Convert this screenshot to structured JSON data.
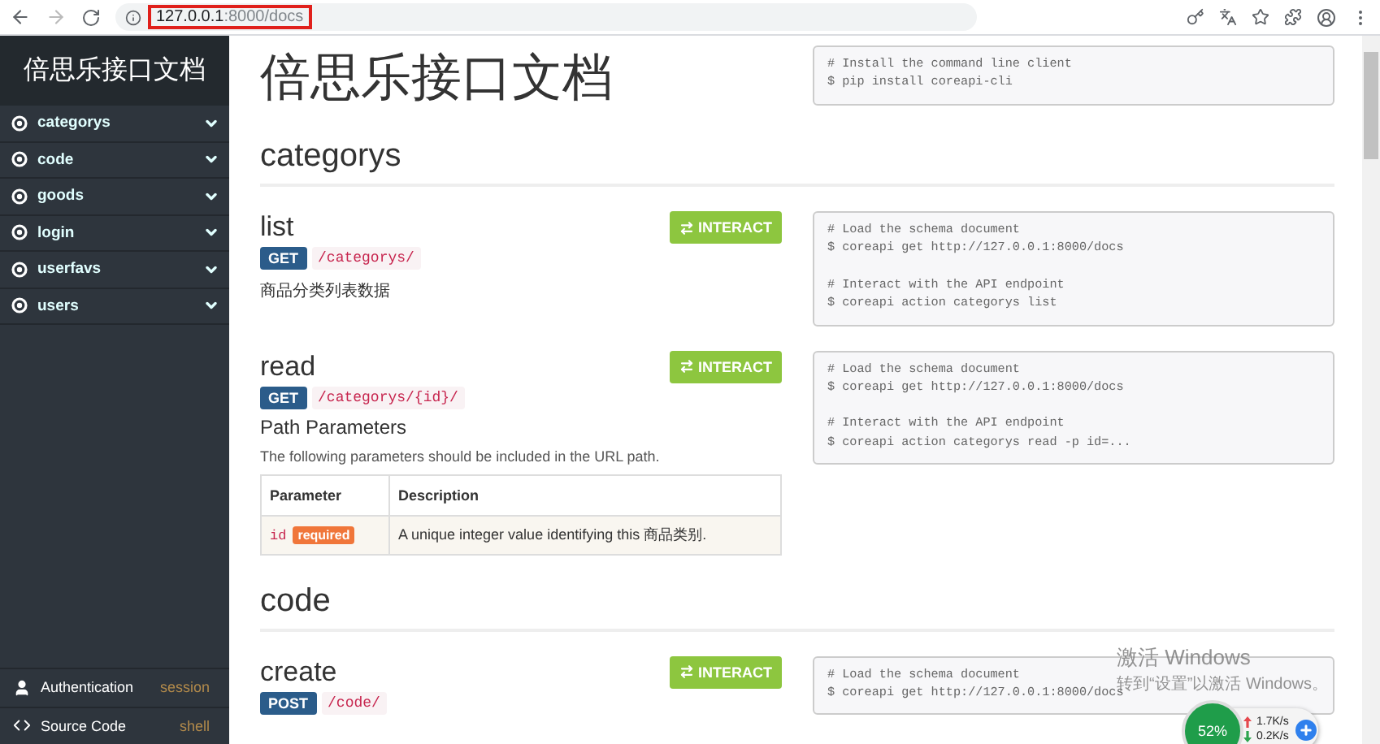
{
  "browser": {
    "url_host": "127.0.0.1",
    "url_rest": ":8000/docs"
  },
  "sidebar": {
    "title": "倍思乐接口文档",
    "items": [
      {
        "label": "categorys",
        "expanded": false
      },
      {
        "label": "code",
        "expanded": false
      },
      {
        "label": "goods",
        "expanded": false
      },
      {
        "label": "login",
        "expanded": false
      },
      {
        "label": "userfavs",
        "expanded": false
      },
      {
        "label": "users",
        "expanded": false
      }
    ],
    "footer": [
      {
        "kind": "auth",
        "label": "Authentication",
        "value": "session"
      },
      {
        "kind": "source",
        "label": "Source Code",
        "value": "shell"
      }
    ]
  },
  "intro": {
    "title": "倍思乐接口文档",
    "code": [
      [
        "# Install the command line client",
        "$ pip install coreapi-cli"
      ]
    ]
  },
  "sections": [
    {
      "title": "categorys",
      "endpoints": [
        {
          "name": "list",
          "button": "INTERACT",
          "method": "GET",
          "path": "/categorys/",
          "description": "商品分类列表数据",
          "code": [
            [
              "# Load the schema document",
              "$ coreapi get http://127.0.0.1:8000/docs"
            ],
            [
              "# Interact with the API endpoint",
              "$ coreapi action categorys list"
            ]
          ]
        },
        {
          "name": "read",
          "button": "INTERACT",
          "method": "GET",
          "path": "/categorys/{id}/",
          "params": {
            "heading": "Path Parameters",
            "note": "The following parameters should be included in the URL path.",
            "columns": [
              "Parameter",
              "Description"
            ],
            "rows": [
              {
                "name": "id",
                "badge": "required",
                "description": "A unique integer value identifying this 商品类别."
              }
            ]
          },
          "code": [
            [
              "# Load the schema document",
              "$ coreapi get http://127.0.0.1:8000/docs"
            ],
            [
              "# Interact with the API endpoint",
              "$ coreapi action categorys read -p id=..."
            ]
          ]
        }
      ]
    },
    {
      "title": "code",
      "endpoints": [
        {
          "name": "create",
          "button": "INTERACT",
          "method": "POST",
          "path": "/code/",
          "code": [
            [
              "# Load the schema document",
              "$ coreapi get http://127.0.0.1:8000/docs"
            ]
          ]
        }
      ]
    }
  ],
  "activation": {
    "title": "激活 Windows",
    "subtitle": "转到“设置”以激活 Windows。"
  },
  "speed_widget": {
    "percent": "52%",
    "up": "1.7K/s",
    "down": "0.2K/s"
  }
}
